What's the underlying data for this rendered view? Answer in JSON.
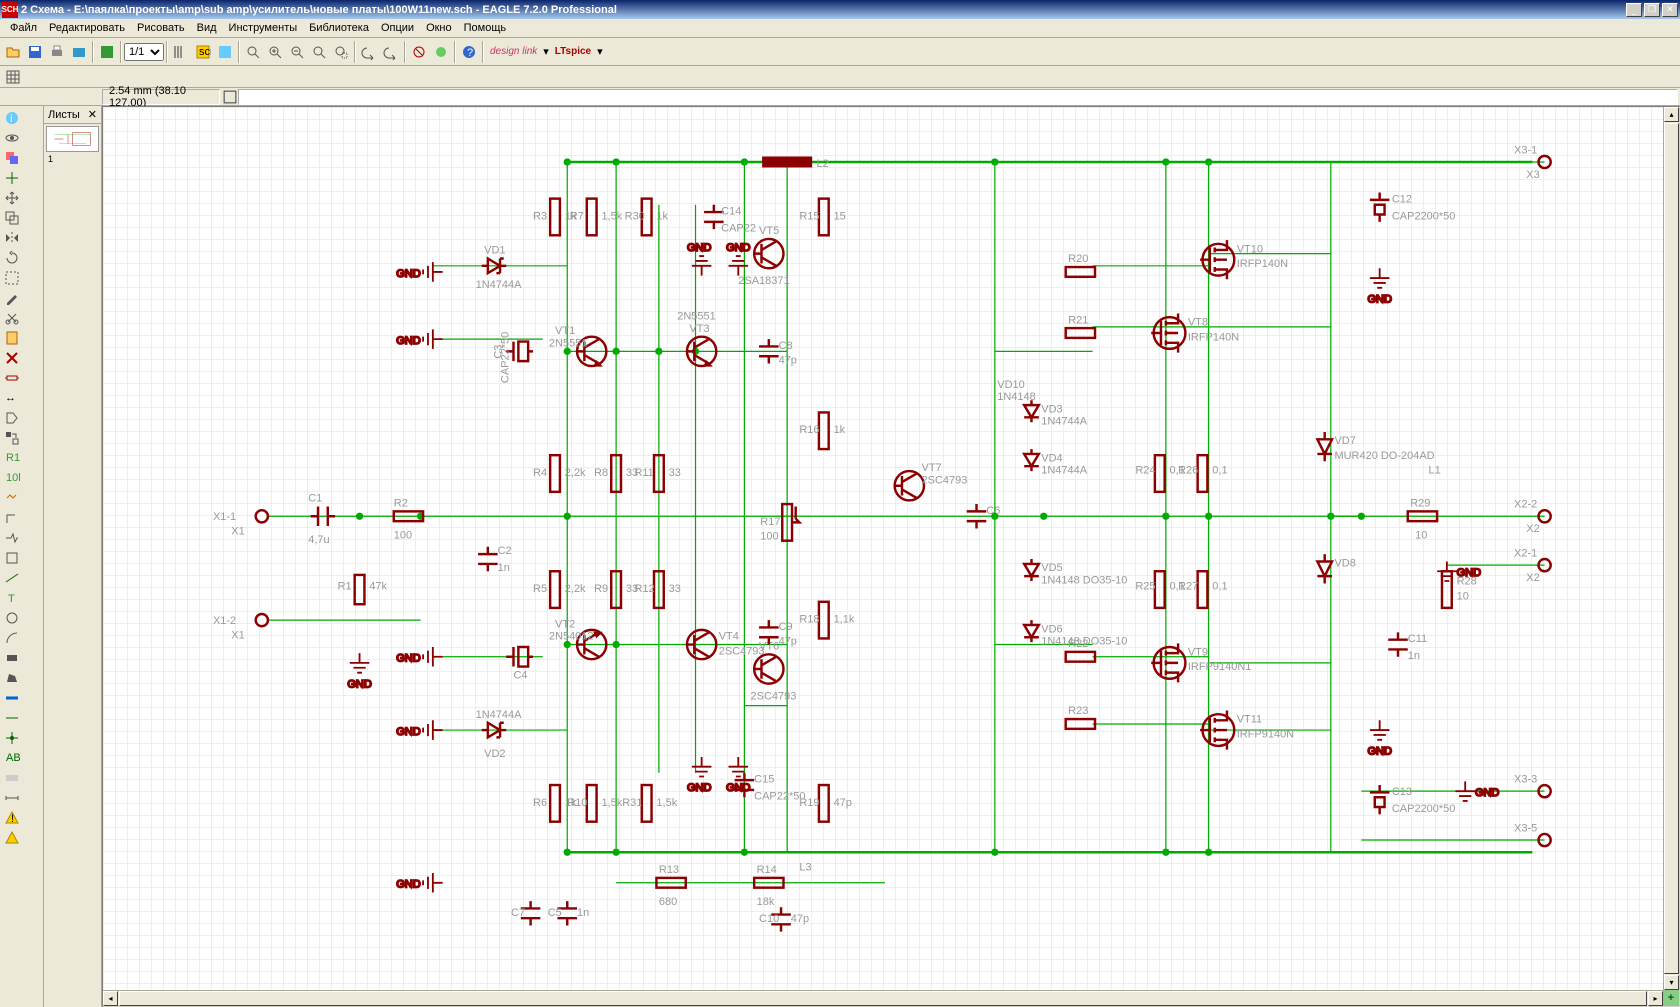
{
  "title": "2 Схема - E:\\паялка\\проекты\\amp\\sub amp\\усилитель\\новые платы\\100W11new.sch - EAGLE 7.2.0 Professional",
  "app_icon": "SCH",
  "win_buttons": {
    "min": "_",
    "max": "❐",
    "close": "✕"
  },
  "menu": [
    "Файл",
    "Редактировать",
    "Рисовать",
    "Вид",
    "Инструменты",
    "Библиотека",
    "Опции",
    "Окно",
    "Помощь"
  ],
  "zoom_value": "1/1",
  "sheets_label": "Листы",
  "sheet_num": "1",
  "coord_text": "2.54 mm (38.10 127.00)",
  "cmd_text": "",
  "designlink": "design link",
  "ltspice": "LTspice",
  "components": {
    "R1": "47k",
    "R2": "100",
    "R3": "1k",
    "R4": "2,2k",
    "R5": "2,2k",
    "R6": "1k",
    "R7": "1,5k",
    "R8": "33",
    "R9": "33",
    "R10": "1,5k",
    "R11": "33",
    "R12": "33",
    "R13": "680",
    "R14": "18k",
    "R15": "15",
    "R16": "1k",
    "R17": "100",
    "R18": "1,1k",
    "R19": "47p",
    "R20": "",
    "R21": "",
    "R22": "",
    "R23": "",
    "R24": "0,1",
    "R25": "0,1",
    "R26": "0,1",
    "R27": "0,1",
    "R28": "10",
    "R29": "10",
    "R30": "1k",
    "R31": "1,5k",
    "C1": "4,7u",
    "C2": "1n",
    "C3": "CAP22*50",
    "C4": "",
    "C5": "1n",
    "C6": "",
    "C7": "",
    "C8": "47p",
    "C9": "47p",
    "C10": "47p",
    "C11": "1n",
    "C12": "CAP2200*50",
    "C13": "CAP2200*50",
    "C14": "CAP22",
    "C15": "CAP22*50",
    "VT1": "2N5551",
    "VT2": "2N54012",
    "VT3": "2N5551",
    "VT4": "2SC4793",
    "VT5": "2SA18371",
    "VT6": "2SC4793",
    "VT7": "2SC4793",
    "VT8": "IRFP140N",
    "VT9": "IRFP9140N1",
    "VT10": "IRFP140N",
    "VT11": "IRFP9140N",
    "VD1": "1N4744A",
    "VD2": "1N4744A",
    "VD3": "1N4744A",
    "VD4": "1N4744A",
    "VD5": "1N4148 DO35-10",
    "VD6": "1N4148 DO35-10",
    "VD7": "MUR420 DO-204AD",
    "VD8": "",
    "VD10": "1N4148",
    "L1": "",
    "L2": "",
    "L3": "",
    "X1": "",
    "X2": "",
    "X3": ""
  },
  "pins": {
    "X1-1": "X1-1",
    "X1-2": "X1-2",
    "X2-1": "X2-1",
    "X2-2": "X2-2",
    "X3-1": "X3-1",
    "X3-3": "X3-3",
    "X3-5": "X3-5"
  },
  "gnd": "GND"
}
